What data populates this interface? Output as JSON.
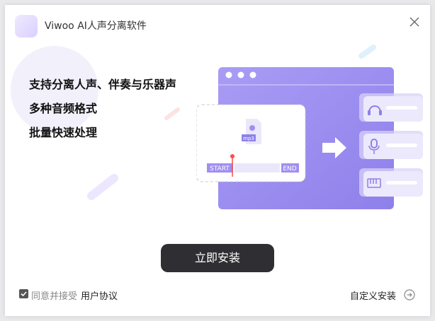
{
  "app": {
    "title": "Viwoo AI人声分离软件"
  },
  "features": [
    "支持分离人声、伴奏与乐器声",
    "多种音频格式",
    "批量快速处理"
  ],
  "illustration": {
    "file_badge": "mp3",
    "start_label": "START",
    "end_label": "END",
    "outputs": [
      {
        "icon": "headphones-icon"
      },
      {
        "icon": "microphone-icon"
      },
      {
        "icon": "piano-icon"
      }
    ]
  },
  "install_button": "立即安装",
  "agreement": {
    "prefix": "同意并接受",
    "link": "用户协议",
    "checked": true
  },
  "custom_install": "自定义安装",
  "colors": {
    "accent": "#9b8ff0",
    "button": "#2f2f33"
  }
}
